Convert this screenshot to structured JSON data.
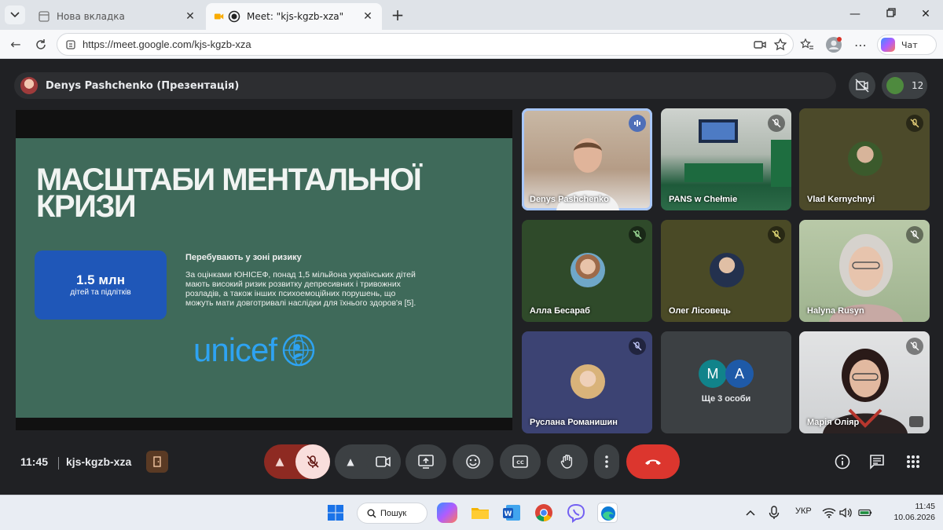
{
  "browser": {
    "tabs": [
      {
        "title": "Нова вкладка",
        "active": false
      },
      {
        "title": "Meet: \"kjs-kgzb-xza\"",
        "active": true
      }
    ],
    "url": "https://meet.google.com/kjs-kgzb-xza",
    "copilot_label": "Чат"
  },
  "meet": {
    "presenter_title": "Denys Pashchenko (Презентація)",
    "participant_count": "12",
    "slide": {
      "title": "МАСШТАБИ МЕНТАЛЬНОЇ КРИЗИ",
      "stat_value": "1.5 млн",
      "stat_label": "дітей та підлітків",
      "risk_heading": "Перебувають у зоні ризику",
      "risk_text": "За оцінками ЮНІСЕФ, понад 1,5 мільйона українських дітей мають високий ризик розвитку депресивних і тривожних розладів, а також інших психоемоційних порушень, що можуть мати довготривалі наслідки для їхнього здоров'я [5].",
      "logo_text": "unicef"
    },
    "tiles": [
      {
        "name": "Denys Pashchenko",
        "state": "speaking"
      },
      {
        "name": "PANS w Chełmie",
        "state": "muted"
      },
      {
        "name": "Vlad Kernychnyi",
        "state": "muted"
      },
      {
        "name": "Алла Бесараб",
        "state": "muted"
      },
      {
        "name": "Олег Лісовець",
        "state": "muted"
      },
      {
        "name": "Halyna Rusyn",
        "state": "muted"
      },
      {
        "name": "Руслана Романишин",
        "state": "muted"
      },
      {
        "name": "Ще 3 особи",
        "initials": [
          "M",
          "A"
        ]
      },
      {
        "name": "Марія Оліяр",
        "state": "muted"
      }
    ],
    "clock": "11:45",
    "meeting_code": "kjs-kgzb-xza"
  },
  "taskbar": {
    "search_label": "Пошук",
    "language": "УКР",
    "time": "11:45",
    "date": "10.06.2026"
  },
  "colors": {
    "slide_bg": "#3f6a5a",
    "stat_box": "#1f57b8",
    "unicef_blue": "#2ea3f2",
    "end_call": "#dc362e",
    "mic_muted": "#8e2a22"
  }
}
